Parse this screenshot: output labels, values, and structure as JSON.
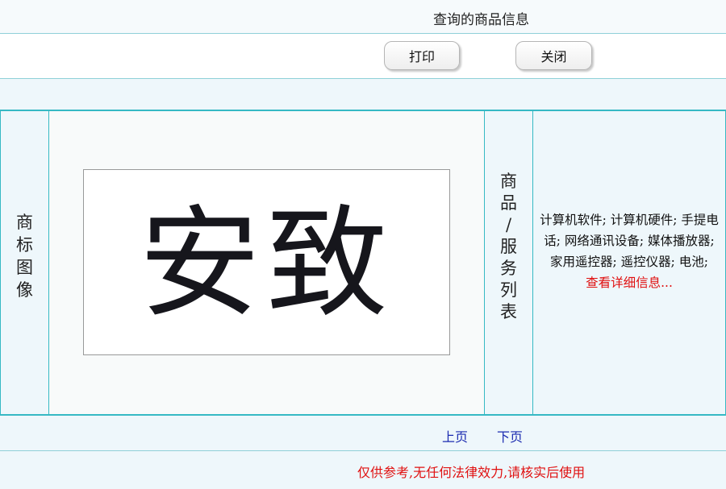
{
  "header": {
    "title": "查询的商品信息"
  },
  "toolbar": {
    "print_label": "打印",
    "close_label": "关闭"
  },
  "labels": {
    "trademark_image": [
      "商",
      "标",
      "图",
      "像"
    ],
    "goods_services": [
      "商",
      "品",
      "/",
      "服",
      "务",
      "列",
      "表"
    ]
  },
  "trademark": {
    "text": "安致"
  },
  "goods": {
    "list": "计算机软件; 计算机硬件; 手提电话; 网络通讯设备; 媒体播放器; 家用遥控器; 遥控仪器; 电池;",
    "more_link": "查看详细信息..."
  },
  "pager": {
    "prev": "上页",
    "next": "下页"
  },
  "notice": "仅供参考,无任何法律效力,请核实后使用",
  "colors": {
    "border_accent": "#36b9c4",
    "link": "#1b2bb0",
    "warning": "#e01010",
    "background": "#eef7fb"
  }
}
